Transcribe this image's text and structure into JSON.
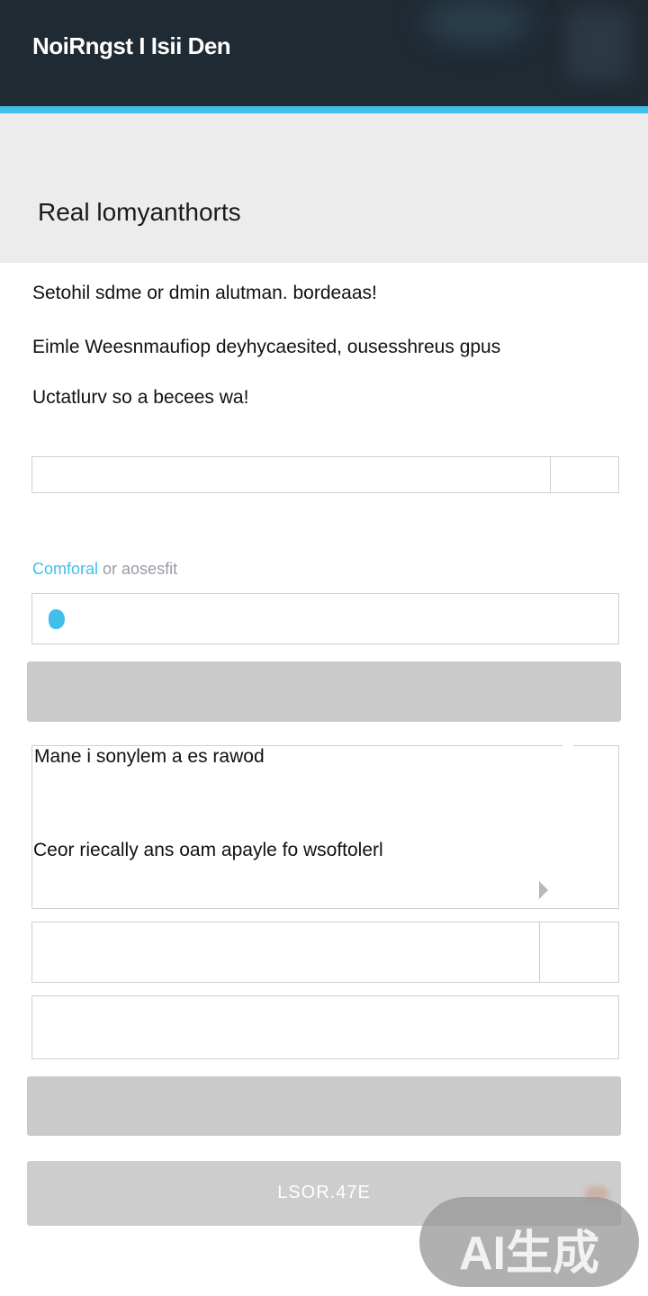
{
  "header": {
    "title": "NoiRngst I Isii Den"
  },
  "hero": {
    "page_title": "Real lomyanthorts"
  },
  "intro": {
    "line1": "Setohil sdme or dmin alutman. bordeaas!",
    "line2": "Eimle Weesnmaufiop deyhycaesited, ousesshreus gpus",
    "line3": "Uctatlurv so a becees wa!"
  },
  "field1": {
    "value": ""
  },
  "section_label": {
    "highlight": "Comforal",
    "rest": " or aosesfit"
  },
  "field2": {
    "value": ""
  },
  "button1": {
    "label": ""
  },
  "info_card": {
    "line1": "Mane i sonylem a es rawod",
    "line2": "Ceor riecally ans oam apayle fo wsoftolerl"
  },
  "field3": {
    "value": ""
  },
  "field4": {
    "value": ""
  },
  "button2": {
    "label": ""
  },
  "button3": {
    "label": "LSOR.47E"
  },
  "watermark": {
    "text": "AI生成"
  },
  "colors": {
    "header_bg": "#1f2a33",
    "accent": "#3fbfea",
    "hero_bg": "#ececec",
    "button_gray": "#cacaca"
  },
  "icons": [
    "blue-dot-icon",
    "play-arrow-icon"
  ]
}
